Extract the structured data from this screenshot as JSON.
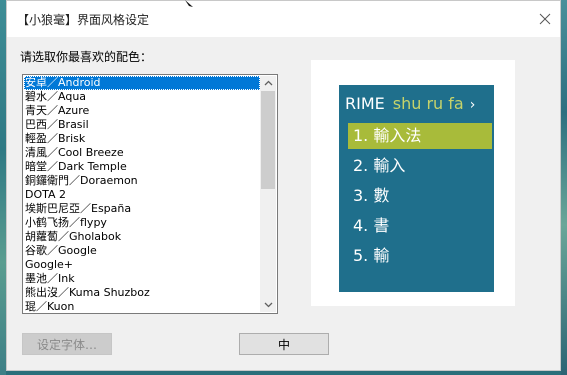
{
  "window": {
    "title": "【小狼毫】界面风格设定"
  },
  "prompt": "请选取你最喜欢的配色：",
  "color_schemes": {
    "selected_index": 0,
    "items": [
      "安卓／Android",
      "碧水／Aqua",
      "青天／Azure",
      "巴西／Brasil",
      "輕盈／Brisk",
      "清風／Cool Breeze",
      "暗堂／Dark Temple",
      "銅鑼衛門／Doraemon",
      "DOTA 2",
      "埃斯巴尼亞／España",
      "小鹤飞扬／flypy",
      "胡蘿蔔／Gholabok",
      "谷歌／Google",
      "Google+",
      "墨池／Ink",
      "熊出沒／Kuma Shuzboz",
      "琨／Kuon"
    ]
  },
  "preview": {
    "schema_name": "RIME",
    "preedit": "shu ru fa",
    "page_arrow": "›",
    "candidates": [
      "1. 輸入法",
      "2. 輸入",
      "3. 數",
      "4. 書",
      "5. 輸"
    ],
    "highlighted_index": 0,
    "colors": {
      "back": "#1f6f8c",
      "text": "#ffffff",
      "preedit": "#c6d36a",
      "highlight": "#a8bb3a"
    }
  },
  "buttons": {
    "font_label": "设定字体…",
    "ok_label": "中"
  }
}
